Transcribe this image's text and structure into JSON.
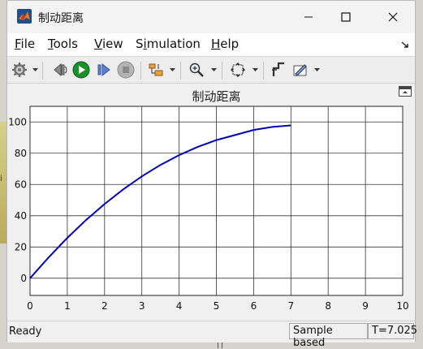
{
  "window": {
    "title": "制动距离"
  },
  "menu": [
    {
      "label": "File",
      "mnemonic": "F",
      "rest": "ile"
    },
    {
      "label": "Tools",
      "mnemonic": "T",
      "rest": "ools"
    },
    {
      "label": "View",
      "mnemonic": "V",
      "rest": "iew"
    },
    {
      "label": "Simulation",
      "pre": "S",
      "mnemonic": "i",
      "rest": "mulation"
    },
    {
      "label": "Help",
      "mnemonic": "H",
      "rest": "elp"
    }
  ],
  "toolbar": {
    "icons": [
      "gear-icon",
      "step-back-icon",
      "run-icon",
      "step-forward-icon",
      "stop-icon",
      "signal-select-icon",
      "zoom-icon",
      "fit-icon",
      "cursor-measure-icon",
      "style-icon"
    ]
  },
  "status": {
    "ready": "Ready",
    "mode": "Sample based",
    "time": "T=7.025"
  },
  "background": {
    "left_fragment": "i"
  },
  "chart_data": {
    "type": "line",
    "title": "制动距离",
    "xlabel": "",
    "ylabel": "",
    "xlim": [
      0,
      10
    ],
    "ylim": [
      -11,
      110
    ],
    "xticks": [
      0,
      1,
      2,
      3,
      4,
      5,
      6,
      7,
      8,
      9,
      10
    ],
    "yticks": [
      0,
      20,
      40,
      60,
      80,
      100
    ],
    "grid": true,
    "series": [
      {
        "color": "#0000b4",
        "x": [
          0,
          0.5,
          1,
          1.5,
          2,
          2.5,
          3,
          3.5,
          4,
          4.5,
          5,
          5.5,
          6,
          6.5,
          7
        ],
        "y": [
          0,
          13.4,
          25.8,
          37.2,
          47.5,
          56.9,
          65.2,
          72.5,
          78.8,
          84.1,
          88.4,
          91.6,
          94.9,
          96.8,
          97.8
        ]
      }
    ],
    "colors": {
      "plot_bg": "#ffffff",
      "grid": "#333333",
      "frame_bg": "#f0f0f0"
    }
  }
}
